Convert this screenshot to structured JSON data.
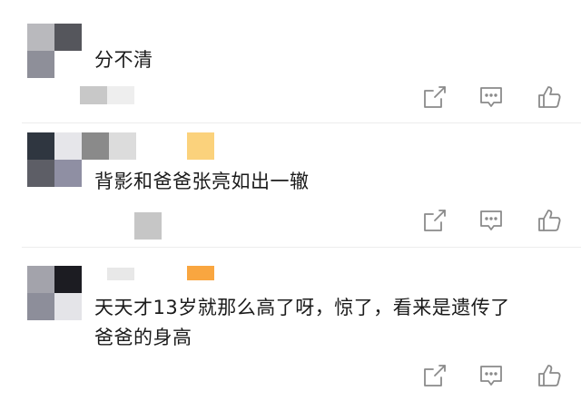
{
  "comments": [
    {
      "text": "分不清",
      "actions": {
        "share_icon": "share-icon",
        "reply_icon": "reply-icon",
        "like_icon": "thumbs-up-icon"
      }
    },
    {
      "text": "背影和爸爸张亮如出一辙",
      "actions": {
        "share_icon": "share-icon",
        "reply_icon": "reply-icon",
        "like_icon": "thumbs-up-icon"
      }
    },
    {
      "text": "天天才13岁就那么高了呀，惊了，看来是遗传了\n爸爸的身高",
      "actions": {
        "share_icon": "share-icon",
        "reply_icon": "reply-icon",
        "like_icon": "thumbs-up-icon"
      }
    }
  ],
  "colors": {
    "icon_stroke": "#8a8a8a",
    "badge_yellow": "#fbd27c",
    "badge_orange": "#f9a640"
  }
}
